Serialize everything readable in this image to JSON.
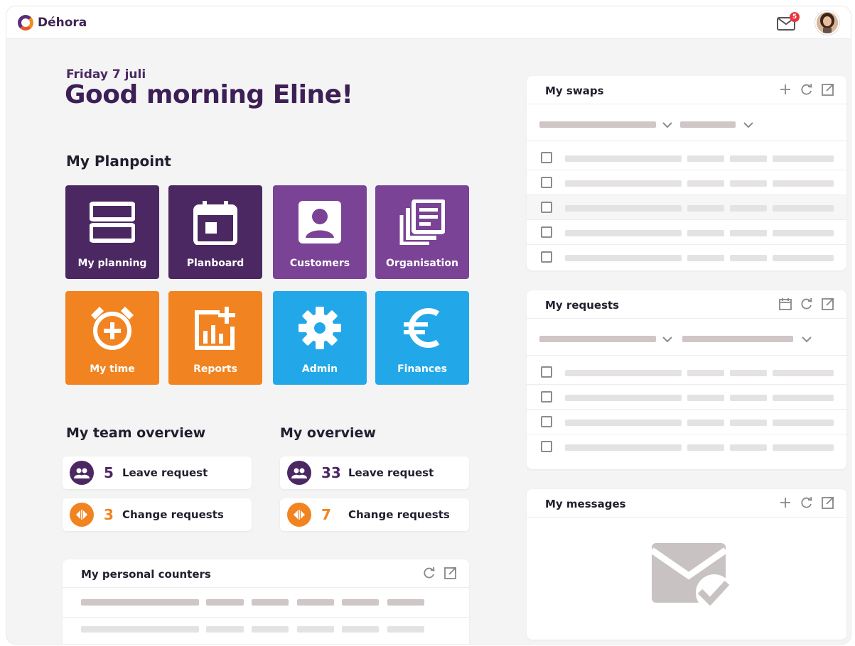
{
  "header": {
    "brand": "Déhora",
    "notifications_count": "5"
  },
  "greeting": {
    "date": "Friday 7 juli",
    "title": "Good morning Eline!"
  },
  "planpoint": {
    "title": "My Planpoint",
    "tiles": [
      {
        "label": "My planning",
        "icon": "planning-icon",
        "color": "#4b2862"
      },
      {
        "label": "Planboard",
        "icon": "calendar-icon",
        "color": "#4b2862"
      },
      {
        "label": "Customers",
        "icon": "customer-icon",
        "color": "#7a4396"
      },
      {
        "label": "Organisation",
        "icon": "organisation-icon",
        "color": "#7a4396"
      },
      {
        "label": "My time",
        "icon": "alarm-clock-icon",
        "color": "#f18420"
      },
      {
        "label": "Reports",
        "icon": "reports-icon",
        "color": "#f18420"
      },
      {
        "label": "Admin",
        "icon": "gear-icon",
        "color": "#22a8e8"
      },
      {
        "label": "Finances",
        "icon": "euro-icon",
        "color": "#22a8e8"
      }
    ]
  },
  "team_overview": {
    "title": "My team overview",
    "leave_count": "5",
    "leave_label": "Leave request",
    "change_count": "3",
    "change_label": "Change requests"
  },
  "my_overview": {
    "title": "My overview",
    "leave_count": "33",
    "leave_label": "Leave request",
    "change_count": "7",
    "change_label": "Change requests"
  },
  "counters": {
    "title": "My personal counters"
  },
  "swaps": {
    "title": "My swaps"
  },
  "requests": {
    "title": "My requests"
  },
  "messages": {
    "title": "My messages"
  },
  "colors": {
    "brand_dark": "#4b2862",
    "brand_purple": "#7a4396",
    "accent_orange": "#f18420",
    "accent_blue": "#22a8e8",
    "badge_red": "#e8353b"
  }
}
